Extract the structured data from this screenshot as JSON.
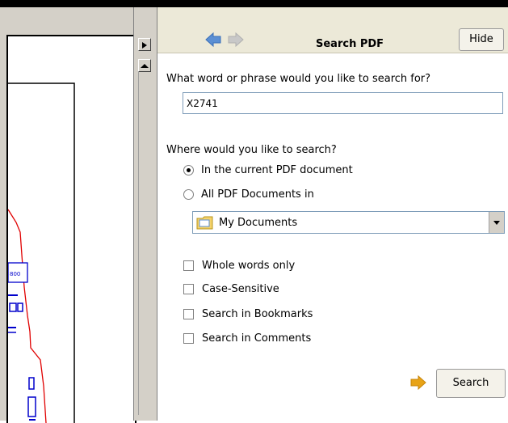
{
  "header": {
    "title": "Search PDF",
    "hide_label": "Hide",
    "back_icon": "back-arrow-icon",
    "forward_icon": "forward-arrow-icon"
  },
  "search": {
    "question": "What word or phrase would you like to search for?",
    "value": "X2741",
    "where_label": "Where would you like to search?"
  },
  "scope": {
    "current_label": "In the current PDF document",
    "all_label": "All PDF Documents in",
    "selected": "current"
  },
  "location": {
    "value": "My Documents",
    "icon": "folder-icon"
  },
  "options": [
    {
      "label": "Whole words only",
      "checked": false
    },
    {
      "label": "Case-Sensitive",
      "checked": false
    },
    {
      "label": "Search in Bookmarks",
      "checked": false
    },
    {
      "label": "Search in Comments",
      "checked": false
    }
  ],
  "actions": {
    "search_label": "Search"
  },
  "document": {
    "visible_label": "800"
  },
  "colors": {
    "accent_arrow": "#e8a317",
    "nav_arrow": "#5b8fd4",
    "outline": "#e00000",
    "shapes": "#0000cc"
  }
}
